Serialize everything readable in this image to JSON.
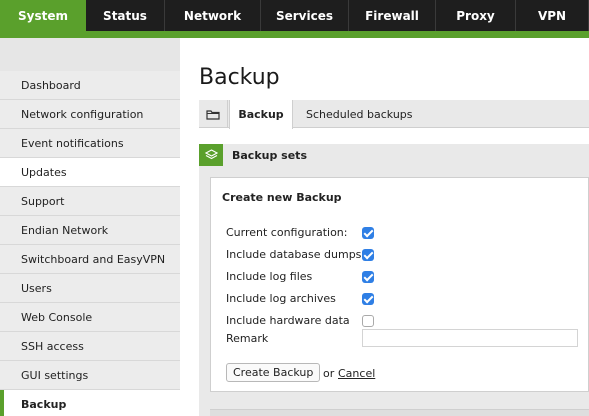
{
  "topnav": {
    "items": [
      {
        "label": "System",
        "active": true
      },
      {
        "label": "Status",
        "active": false
      },
      {
        "label": "Network",
        "active": false
      },
      {
        "label": "Services",
        "active": false
      },
      {
        "label": "Firewall",
        "active": false
      },
      {
        "label": "Proxy",
        "active": false
      },
      {
        "label": "VPN",
        "active": false
      }
    ]
  },
  "sidebar": {
    "items": [
      {
        "label": "Dashboard"
      },
      {
        "label": "Network configuration"
      },
      {
        "label": "Event notifications"
      },
      {
        "label": "Updates"
      },
      {
        "label": "Support"
      },
      {
        "label": "Endian Network"
      },
      {
        "label": "Switchboard and EasyVPN"
      },
      {
        "label": "Users"
      },
      {
        "label": "Web Console"
      },
      {
        "label": "SSH access"
      },
      {
        "label": "GUI settings"
      },
      {
        "label": "Backup"
      }
    ],
    "active": "Backup"
  },
  "main": {
    "title": "Backup",
    "tabs": [
      {
        "label": "Backup",
        "active": true
      },
      {
        "label": "Scheduled backups",
        "active": false
      }
    ],
    "section_title": "Backup sets",
    "create": {
      "title": "Create new Backup",
      "options": [
        {
          "label": "Current configuration:",
          "checked": true
        },
        {
          "label": "Include database dumps",
          "checked": true
        },
        {
          "label": "Include log files",
          "checked": true
        },
        {
          "label": "Include log archives",
          "checked": true
        },
        {
          "label": "Include hardware data",
          "checked": false
        }
      ],
      "remark_label": "Remark",
      "remark_value": "",
      "create_button": "Create Backup",
      "or_text": "or",
      "cancel_link": "Cancel"
    }
  },
  "colors": {
    "accent": "#5aa02c",
    "nav_bg": "#1e1e1e",
    "checkbox": "#2f7fe5"
  }
}
